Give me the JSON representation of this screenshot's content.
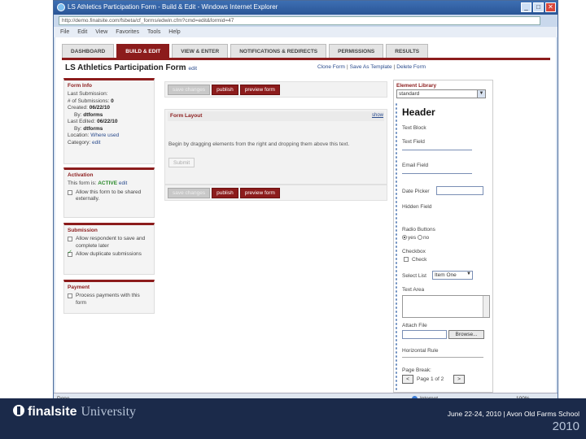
{
  "window": {
    "title": "LS Athletics Participation Form - Build & Edit - Windows Internet Explorer",
    "address": "http://demo.finalsite.com/fsbeta/cf_forms/edwin.cfm?cmd=edit&formid=47",
    "menu": [
      "File",
      "Edit",
      "View",
      "Favorites",
      "Tools",
      "Help"
    ],
    "buttons": {
      "minimize": "_",
      "maximize": "□",
      "close": "✕"
    }
  },
  "tabs": [
    {
      "label": "DASHBOARD",
      "active": false
    },
    {
      "label": "BUILD & EDIT",
      "active": true
    },
    {
      "label": "VIEW & ENTER",
      "active": false
    },
    {
      "label": "NOTIFICATIONS & REDIRECTS",
      "active": false
    },
    {
      "label": "PERMISSIONS",
      "active": false
    },
    {
      "label": "RESULTS",
      "active": false
    }
  ],
  "form_title": "LS Athletics Participation Form",
  "form_title_edit": "edit",
  "top_links": {
    "clone": "Clone Form",
    "save_template": "Save As Template",
    "delete": "Delete Form"
  },
  "form_info": {
    "header": "Form Info",
    "last_submission": "Last Submission:",
    "submissions_label": "# of Submissions:",
    "submissions_value": "0",
    "created_label": "Created:",
    "created_value": "06/22/10",
    "created_by_label": "By:",
    "created_by_value": "dtforms",
    "edited_label": "Last Edited:",
    "edited_value": "06/22/10",
    "edited_by_label": "By:",
    "edited_by_value": "dtforms",
    "location_label": "Location:",
    "location_value": "Where used",
    "category_label": "Category:",
    "category_value": "edit"
  },
  "activation": {
    "header": "Activation",
    "status_label": "This form is:",
    "status_value": "ACTIVE",
    "status_edit": "edit",
    "share_label": "Allow this form to be shared externally."
  },
  "submission": {
    "header": "Submission",
    "save_later": "Allow respondent to save and complete later",
    "duplicates": "Allow duplicate submissions"
  },
  "payment": {
    "header": "Payment",
    "process": "Process payments with this form"
  },
  "actions": {
    "save": "save changes",
    "publish": "publish",
    "preview": "preview form"
  },
  "layout": {
    "header": "Form Layout",
    "show": "show",
    "instructions": "Begin by dragging elements from the right and dropping them above this text.",
    "submit": "Submit"
  },
  "library": {
    "header": "Element Library",
    "select": "standard",
    "header_el": "Header",
    "text_block": "Text Block",
    "text_field": "Text Field",
    "email_field": "Email Field",
    "date_picker": "Date Picker",
    "hidden_field": "Hidden Field",
    "radio_buttons": "Radio Buttons",
    "radio_yes": "yes",
    "radio_no": "no",
    "checkbox": "Checkbox",
    "checkbox_label": "Check",
    "select_list": "Select List",
    "select_value": "Item One",
    "text_area": "Text Area",
    "attach_file": "Attach File",
    "browse": "Browse...",
    "horizontal_rule": "Horizontal Rule",
    "page_break": "Page Break:",
    "page_of": "Page 1 of 2",
    "prev": "<",
    "next": ">"
  },
  "status": {
    "done": "Done",
    "zone": "Internet",
    "zoom": "100%"
  },
  "footer": {
    "brand": "finalsite",
    "university": "University",
    "event": "June 22-24, 2010 | Avon Old Farms School",
    "year": "2010"
  }
}
